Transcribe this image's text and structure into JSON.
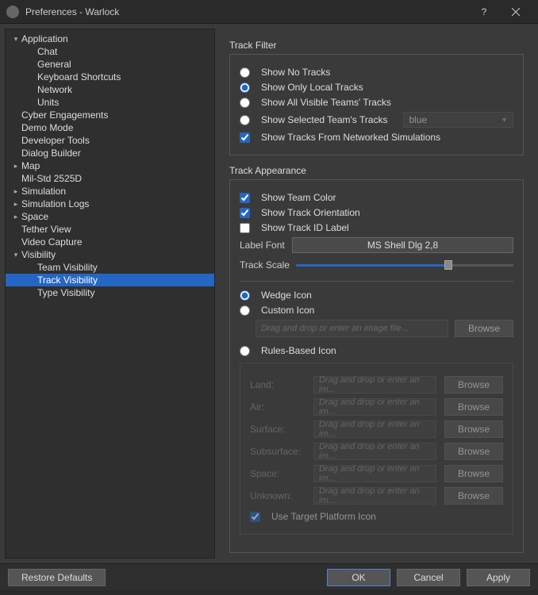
{
  "titlebar": {
    "title": "Preferences - Warlock"
  },
  "tree": [
    {
      "label": "Application",
      "depth": 0,
      "expand": "open"
    },
    {
      "label": "Chat",
      "depth": 1,
      "expand": ""
    },
    {
      "label": "General",
      "depth": 1,
      "expand": ""
    },
    {
      "label": "Keyboard Shortcuts",
      "depth": 1,
      "expand": ""
    },
    {
      "label": "Network",
      "depth": 1,
      "expand": ""
    },
    {
      "label": "Units",
      "depth": 1,
      "expand": ""
    },
    {
      "label": "Cyber Engagements",
      "depth": 0,
      "expand": ""
    },
    {
      "label": "Demo Mode",
      "depth": 0,
      "expand": ""
    },
    {
      "label": "Developer Tools",
      "depth": 0,
      "expand": ""
    },
    {
      "label": "Dialog Builder",
      "depth": 0,
      "expand": ""
    },
    {
      "label": "Map",
      "depth": 0,
      "expand": "closed"
    },
    {
      "label": "Mil-Std 2525D",
      "depth": 0,
      "expand": ""
    },
    {
      "label": "Simulation",
      "depth": 0,
      "expand": "closed"
    },
    {
      "label": "Simulation Logs",
      "depth": 0,
      "expand": "closed"
    },
    {
      "label": "Space",
      "depth": 0,
      "expand": "closed"
    },
    {
      "label": "Tether View",
      "depth": 0,
      "expand": ""
    },
    {
      "label": "Video Capture",
      "depth": 0,
      "expand": ""
    },
    {
      "label": "Visibility",
      "depth": 0,
      "expand": "open"
    },
    {
      "label": "Team Visibility",
      "depth": 1,
      "expand": ""
    },
    {
      "label": "Track Visibility",
      "depth": 1,
      "expand": "",
      "selected": true
    },
    {
      "label": "Type Visibility",
      "depth": 1,
      "expand": ""
    }
  ],
  "filter": {
    "title": "Track Filter",
    "opts": {
      "none": "Show No Tracks",
      "local": "Show Only Local Tracks",
      "visible": "Show All Visible Teams' Tracks",
      "selected": "Show Selected Team's Tracks",
      "team": "blue",
      "networked": "Show Tracks From Networked Simulations"
    }
  },
  "appearance": {
    "title": "Track Appearance",
    "teamcolor": "Show Team Color",
    "orientation": "Show Track Orientation",
    "idlabel": "Show Track ID Label",
    "labelfont_lbl": "Label Font",
    "labelfont_val": "MS Shell Dlg 2,8",
    "trackscale": "Track Scale",
    "wedge": "Wedge Icon",
    "custom": "Custom Icon",
    "custom_placeholder": "Drag and drop or enter an image file...",
    "browse": "Browse",
    "rules": "Rules-Based Icon",
    "categories": [
      "Land:",
      "Air:",
      "Surface:",
      "Subsurface:",
      "Space:",
      "Unknown:"
    ],
    "cat_placeholder": "Drag and drop or enter an im...",
    "target_platform": "Use Target Platform Icon"
  },
  "footer": {
    "restore": "Restore Defaults",
    "ok": "OK",
    "cancel": "Cancel",
    "apply": "Apply"
  }
}
